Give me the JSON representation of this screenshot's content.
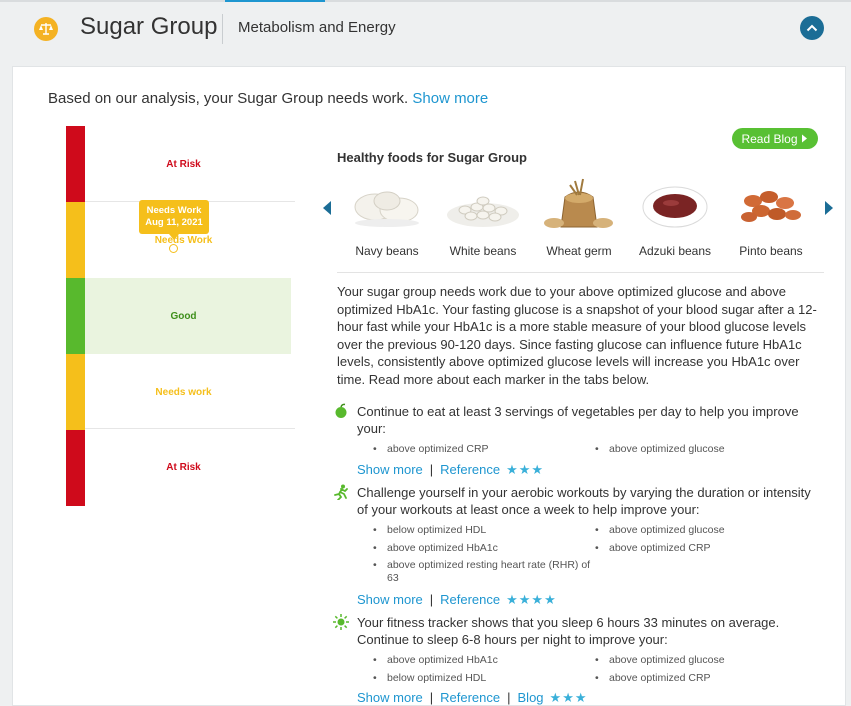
{
  "colors": {
    "accent": "#1e96d0",
    "at_risk": "#cf0a1b",
    "needs_work": "#f5bf1b",
    "good": "#58b92d",
    "header_dark": "#1b6d96"
  },
  "header": {
    "icon": "scale-balance-icon",
    "title": "Sugar Group",
    "subtitle": "Metabolism and Energy"
  },
  "summary": {
    "text": "Based on our analysis, your Sugar Group needs work.",
    "show_more": "Show more"
  },
  "gauge": {
    "zones": [
      {
        "label": "At Risk",
        "color": "#cf0a1b"
      },
      {
        "label": "Needs Work",
        "color": "#f5bf1b"
      },
      {
        "label": "Good",
        "color": "#58b92d"
      },
      {
        "label": "Needs work",
        "color": "#f5bf1b"
      },
      {
        "label": "At Risk",
        "color": "#cf0a1b"
      }
    ],
    "marker": {
      "status": "Needs Work",
      "date": "Aug 11, 2021"
    }
  },
  "foods": {
    "read_blog": "Read Blog",
    "title": "Healthy foods for Sugar Group",
    "items": [
      {
        "name": "Navy beans",
        "icon": "navy-beans-image"
      },
      {
        "name": "White beans",
        "icon": "white-beans-image"
      },
      {
        "name": "Wheat germ",
        "icon": "wheat-germ-image"
      },
      {
        "name": "Adzuki beans",
        "icon": "adzuki-beans-image"
      },
      {
        "name": "Pinto beans",
        "icon": "pinto-beans-image"
      }
    ]
  },
  "description": "Your sugar group needs work due to your above optimized glucose and above optimized HbA1c. Your fasting glucose is a snapshot of your blood sugar after a 12-hour fast while your HbA1c is a more stable measure of your blood glucose levels over the previous 90-120 days. Since fasting glucose can influence future HbA1c levels, consistently above optimized glucose levels will increase you HbA1c over time. Read more about each marker in the tabs below.",
  "recommendations": [
    {
      "icon": "apple-icon",
      "text": "Continue to eat at least 3 servings of vegetables per day to help you improve your:",
      "bullets": [
        "above optimized CRP",
        "above optimized glucose"
      ],
      "show_more": "Show more",
      "reference": "Reference",
      "stars": "★★★"
    },
    {
      "icon": "runner-icon",
      "text": "Challenge yourself in your aerobic workouts by varying the duration or intensity of your workouts at least once a week to help improve your:",
      "bullets": [
        "below optimized HDL",
        "above optimized glucose",
        "above optimized HbA1c",
        "above optimized CRP",
        "above optimized resting heart rate (RHR) of 63"
      ],
      "show_more": "Show more",
      "reference": "Reference",
      "stars": "★★★★"
    },
    {
      "icon": "sun-icon",
      "text": "Your fitness tracker shows that you sleep 6 hours 33 minutes on average. Continue to sleep 6-8 hours per night to improve your:",
      "bullets": [
        "above optimized HbA1c",
        "above optimized glucose",
        "below optimized HDL",
        "above optimized CRP"
      ],
      "show_more": "Show more",
      "reference": "Reference",
      "blog": "Blog",
      "stars": "★★★"
    }
  ]
}
